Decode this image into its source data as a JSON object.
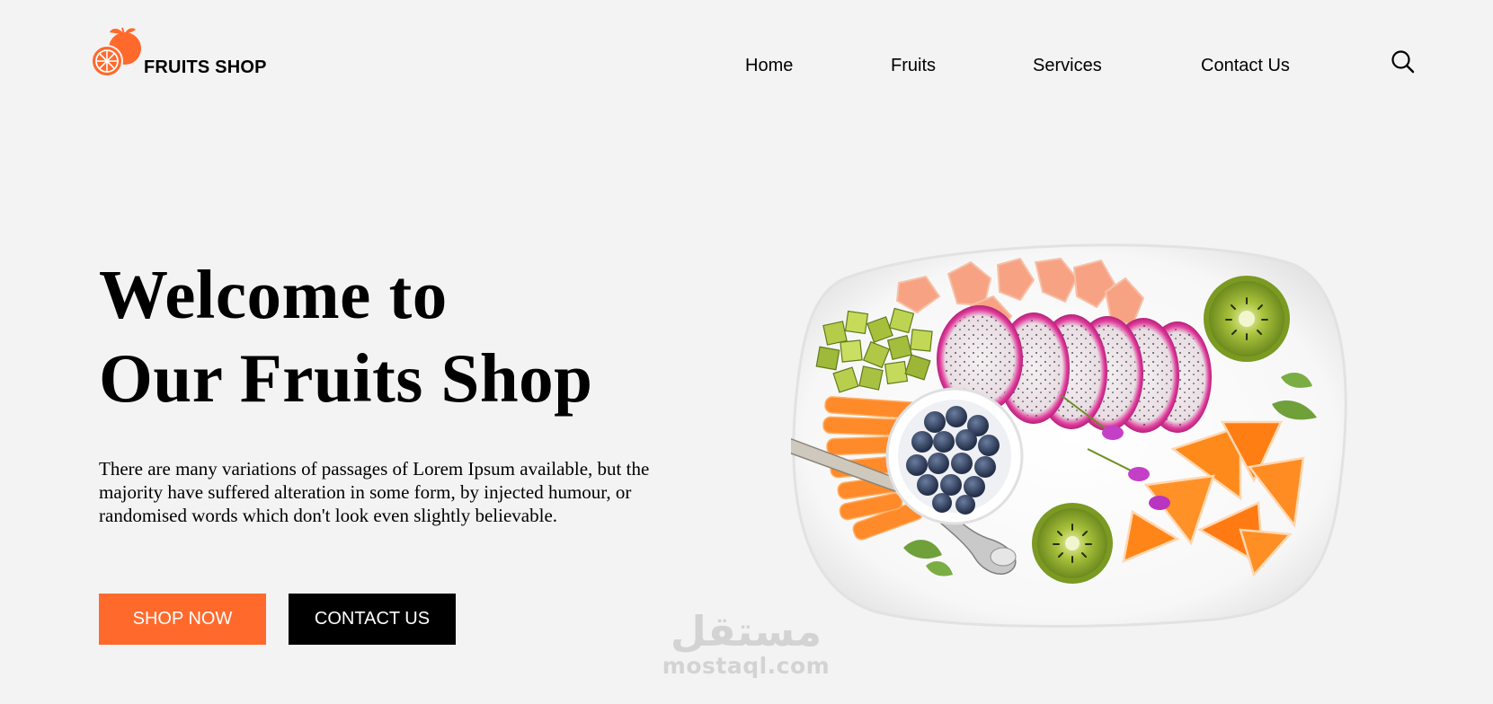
{
  "brand": {
    "name": "FRUITS SHOP",
    "accent_color": "#ff6a2c"
  },
  "nav": {
    "items": [
      {
        "label": "Home"
      },
      {
        "label": "Fruits"
      },
      {
        "label": "Services"
      },
      {
        "label": "Contact Us"
      }
    ],
    "search_icon": "search-icon"
  },
  "hero": {
    "title_line1": "Welcome to",
    "title_line2": "Our Fruits Shop",
    "description": "There are many variations of passages of Lorem Ipsum available, but the majority have suffered alteration in some form, by injected humour, or randomised words which don't look even slightly believable.",
    "shop_button": "SHOP NOW",
    "contact_button": "CONTACT US",
    "image": "fruit-plate-image"
  },
  "watermark": {
    "arabic": "مستقل",
    "latin": "mostaql.com"
  }
}
